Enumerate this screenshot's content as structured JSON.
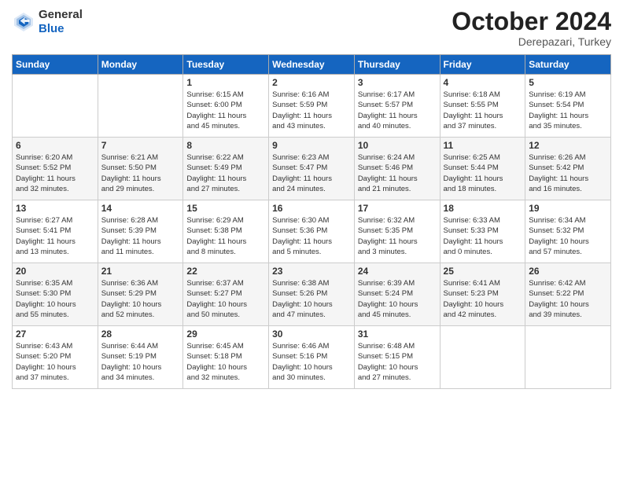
{
  "header": {
    "logo_line1": "General",
    "logo_line2": "Blue",
    "month_year": "October 2024",
    "location": "Derepazari, Turkey"
  },
  "weekdays": [
    "Sunday",
    "Monday",
    "Tuesday",
    "Wednesday",
    "Thursday",
    "Friday",
    "Saturday"
  ],
  "weeks": [
    [
      {
        "day": "",
        "info": ""
      },
      {
        "day": "",
        "info": ""
      },
      {
        "day": "1",
        "info": "Sunrise: 6:15 AM\nSunset: 6:00 PM\nDaylight: 11 hours\nand 45 minutes."
      },
      {
        "day": "2",
        "info": "Sunrise: 6:16 AM\nSunset: 5:59 PM\nDaylight: 11 hours\nand 43 minutes."
      },
      {
        "day": "3",
        "info": "Sunrise: 6:17 AM\nSunset: 5:57 PM\nDaylight: 11 hours\nand 40 minutes."
      },
      {
        "day": "4",
        "info": "Sunrise: 6:18 AM\nSunset: 5:55 PM\nDaylight: 11 hours\nand 37 minutes."
      },
      {
        "day": "5",
        "info": "Sunrise: 6:19 AM\nSunset: 5:54 PM\nDaylight: 11 hours\nand 35 minutes."
      }
    ],
    [
      {
        "day": "6",
        "info": "Sunrise: 6:20 AM\nSunset: 5:52 PM\nDaylight: 11 hours\nand 32 minutes."
      },
      {
        "day": "7",
        "info": "Sunrise: 6:21 AM\nSunset: 5:50 PM\nDaylight: 11 hours\nand 29 minutes."
      },
      {
        "day": "8",
        "info": "Sunrise: 6:22 AM\nSunset: 5:49 PM\nDaylight: 11 hours\nand 27 minutes."
      },
      {
        "day": "9",
        "info": "Sunrise: 6:23 AM\nSunset: 5:47 PM\nDaylight: 11 hours\nand 24 minutes."
      },
      {
        "day": "10",
        "info": "Sunrise: 6:24 AM\nSunset: 5:46 PM\nDaylight: 11 hours\nand 21 minutes."
      },
      {
        "day": "11",
        "info": "Sunrise: 6:25 AM\nSunset: 5:44 PM\nDaylight: 11 hours\nand 18 minutes."
      },
      {
        "day": "12",
        "info": "Sunrise: 6:26 AM\nSunset: 5:42 PM\nDaylight: 11 hours\nand 16 minutes."
      }
    ],
    [
      {
        "day": "13",
        "info": "Sunrise: 6:27 AM\nSunset: 5:41 PM\nDaylight: 11 hours\nand 13 minutes."
      },
      {
        "day": "14",
        "info": "Sunrise: 6:28 AM\nSunset: 5:39 PM\nDaylight: 11 hours\nand 11 minutes."
      },
      {
        "day": "15",
        "info": "Sunrise: 6:29 AM\nSunset: 5:38 PM\nDaylight: 11 hours\nand 8 minutes."
      },
      {
        "day": "16",
        "info": "Sunrise: 6:30 AM\nSunset: 5:36 PM\nDaylight: 11 hours\nand 5 minutes."
      },
      {
        "day": "17",
        "info": "Sunrise: 6:32 AM\nSunset: 5:35 PM\nDaylight: 11 hours\nand 3 minutes."
      },
      {
        "day": "18",
        "info": "Sunrise: 6:33 AM\nSunset: 5:33 PM\nDaylight: 11 hours\nand 0 minutes."
      },
      {
        "day": "19",
        "info": "Sunrise: 6:34 AM\nSunset: 5:32 PM\nDaylight: 10 hours\nand 57 minutes."
      }
    ],
    [
      {
        "day": "20",
        "info": "Sunrise: 6:35 AM\nSunset: 5:30 PM\nDaylight: 10 hours\nand 55 minutes."
      },
      {
        "day": "21",
        "info": "Sunrise: 6:36 AM\nSunset: 5:29 PM\nDaylight: 10 hours\nand 52 minutes."
      },
      {
        "day": "22",
        "info": "Sunrise: 6:37 AM\nSunset: 5:27 PM\nDaylight: 10 hours\nand 50 minutes."
      },
      {
        "day": "23",
        "info": "Sunrise: 6:38 AM\nSunset: 5:26 PM\nDaylight: 10 hours\nand 47 minutes."
      },
      {
        "day": "24",
        "info": "Sunrise: 6:39 AM\nSunset: 5:24 PM\nDaylight: 10 hours\nand 45 minutes."
      },
      {
        "day": "25",
        "info": "Sunrise: 6:41 AM\nSunset: 5:23 PM\nDaylight: 10 hours\nand 42 minutes."
      },
      {
        "day": "26",
        "info": "Sunrise: 6:42 AM\nSunset: 5:22 PM\nDaylight: 10 hours\nand 39 minutes."
      }
    ],
    [
      {
        "day": "27",
        "info": "Sunrise: 6:43 AM\nSunset: 5:20 PM\nDaylight: 10 hours\nand 37 minutes."
      },
      {
        "day": "28",
        "info": "Sunrise: 6:44 AM\nSunset: 5:19 PM\nDaylight: 10 hours\nand 34 minutes."
      },
      {
        "day": "29",
        "info": "Sunrise: 6:45 AM\nSunset: 5:18 PM\nDaylight: 10 hours\nand 32 minutes."
      },
      {
        "day": "30",
        "info": "Sunrise: 6:46 AM\nSunset: 5:16 PM\nDaylight: 10 hours\nand 30 minutes."
      },
      {
        "day": "31",
        "info": "Sunrise: 6:48 AM\nSunset: 5:15 PM\nDaylight: 10 hours\nand 27 minutes."
      },
      {
        "day": "",
        "info": ""
      },
      {
        "day": "",
        "info": ""
      }
    ]
  ]
}
